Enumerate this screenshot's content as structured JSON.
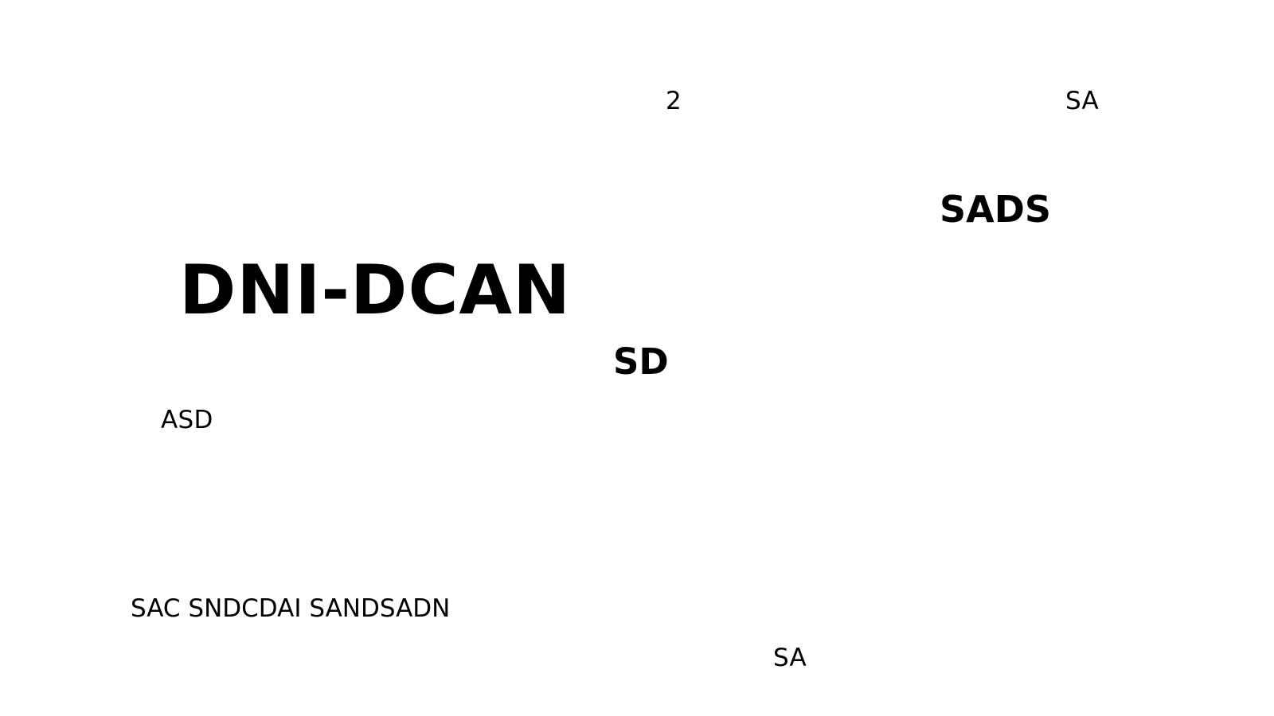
{
  "texts": {
    "number_2": "2",
    "sa_top": "SA",
    "sads": "SADS",
    "dni_dcan": "DNI-DCAN",
    "sd": "SD",
    "asd": "ASD",
    "sac_line": "SAC SNDCDAI SANDSADN",
    "sa_bottom": "SA"
  },
  "colors": {
    "background": "#ffffff",
    "text": "#000000"
  }
}
